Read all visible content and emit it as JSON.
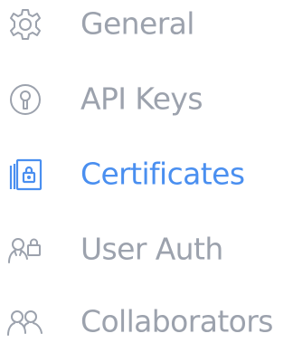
{
  "colors": {
    "inactive": "#9ca2ad",
    "active": "#4a8ff0",
    "background": "#ffffff"
  },
  "menu": {
    "items": [
      {
        "label": "General",
        "icon": "gear-icon",
        "active": false
      },
      {
        "label": "API Keys",
        "icon": "key-icon",
        "active": false
      },
      {
        "label": "Certificates",
        "icon": "certificate-lock-icon",
        "active": true
      },
      {
        "label": "User Auth",
        "icon": "user-lock-icon",
        "active": false
      },
      {
        "label": "Collaborators",
        "icon": "collaborators-icon",
        "active": false
      }
    ]
  }
}
